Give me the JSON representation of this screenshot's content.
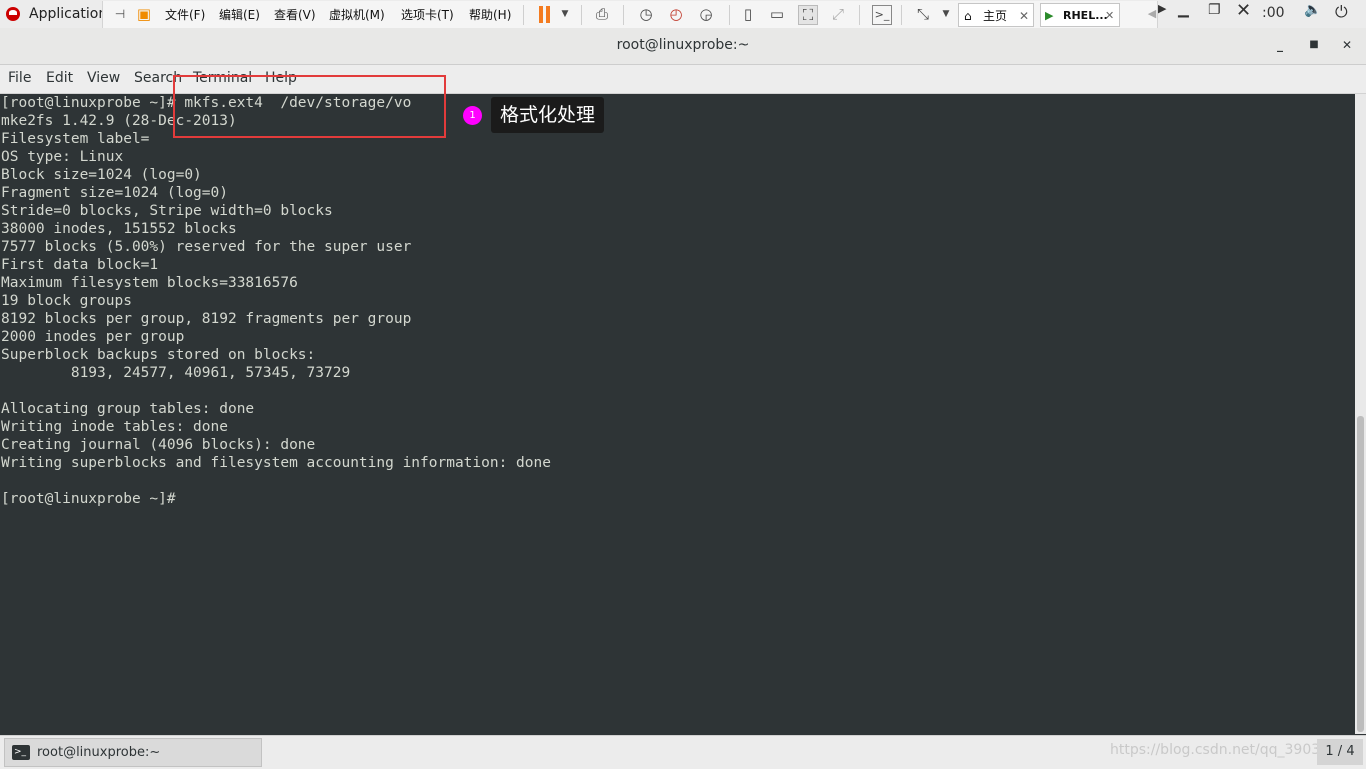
{
  "topbar": {
    "applications_label": "Application",
    "clock_fragment": ":00",
    "vm_menus": [
      "文件(F)",
      "编辑(E)",
      "查看(V)",
      "虚拟机(M)",
      "选项卡(T)",
      "帮助(H)"
    ],
    "home_tab": "主页",
    "rhel_tab": "RHEL..."
  },
  "window": {
    "title": "root@linuxprobe:~",
    "menus": [
      "File",
      "Edit",
      "View",
      "Search",
      "Terminal",
      "Help"
    ]
  },
  "terminal": {
    "lines": [
      "[root@linuxprobe ~]# mkfs.ext4  /dev/storage/vo",
      "mke2fs 1.42.9 (28-Dec-2013)",
      "Filesystem label=",
      "OS type: Linux",
      "Block size=1024 (log=0)",
      "Fragment size=1024 (log=0)",
      "Stride=0 blocks, Stripe width=0 blocks",
      "38000 inodes, 151552 blocks",
      "7577 blocks (5.00%) reserved for the super user",
      "First data block=1",
      "Maximum filesystem blocks=33816576",
      "19 block groups",
      "8192 blocks per group, 8192 fragments per group",
      "2000 inodes per group",
      "Superblock backups stored on blocks:",
      "        8193, 24577, 40961, 57345, 73729",
      "",
      "Allocating group tables: done",
      "Writing inode tables: done",
      "Creating journal (4096 blocks): done",
      "Writing superblocks and filesystem accounting information: done",
      "",
      "[root@linuxprobe ~]#"
    ]
  },
  "annotation": {
    "number": "1",
    "text": "格式化处理"
  },
  "taskbar": {
    "window_label": "root@linuxprobe:~",
    "watermark": "https://blog.csdn.net/qq_39032",
    "workspace": "1 / 4"
  }
}
